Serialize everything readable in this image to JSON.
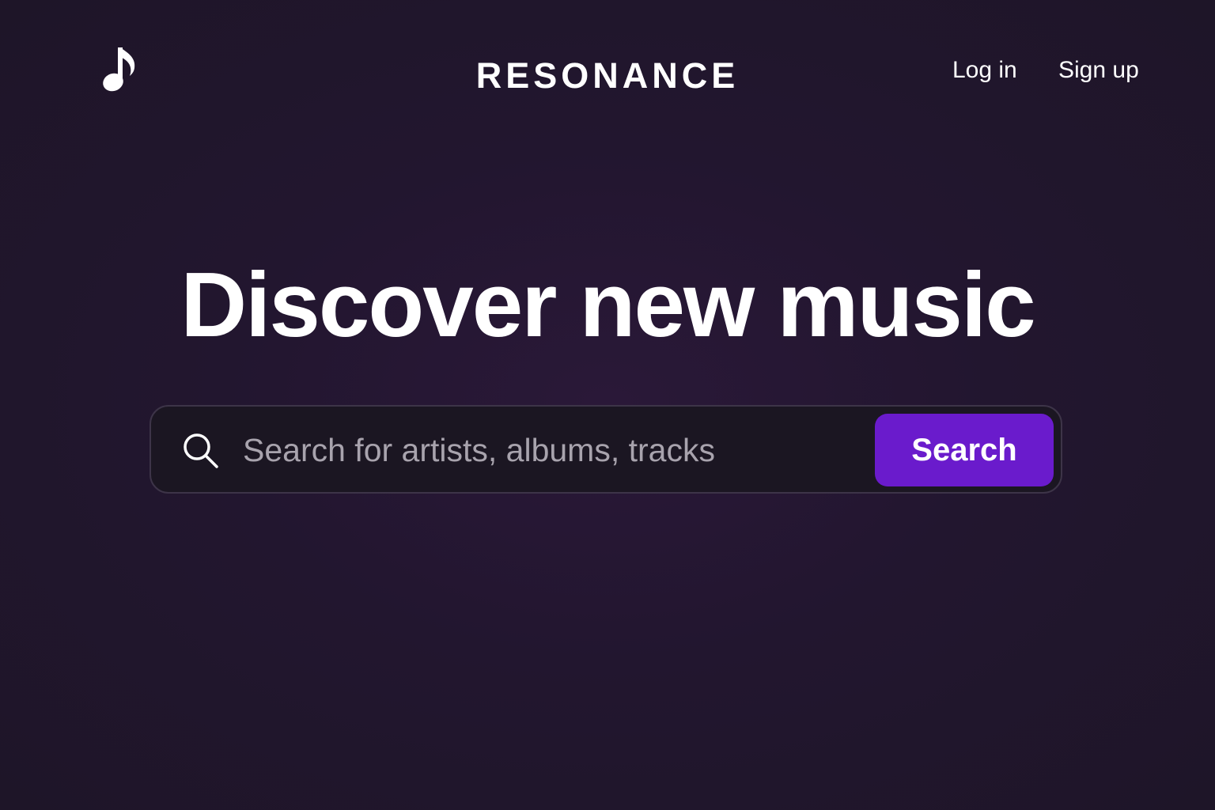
{
  "header": {
    "logo_icon": "music-note-icon",
    "brand": "RESONANCE",
    "login_label": "Log in",
    "signup_label": "Sign up"
  },
  "hero": {
    "title": "Discover new music"
  },
  "search": {
    "icon": "search-icon",
    "placeholder": "Search for artists, albums, tracks",
    "value": "",
    "button_label": "Search"
  },
  "colors": {
    "background": "#221830",
    "accent": "#6a1bcc",
    "text": "#ffffff",
    "placeholder": "#a8a3ad"
  }
}
